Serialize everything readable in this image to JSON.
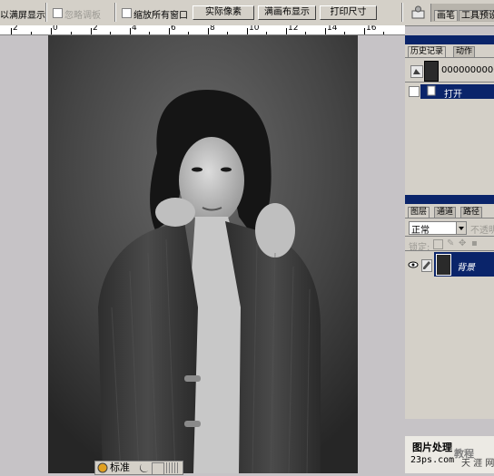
{
  "options_bar": {
    "fit_screen_label": "以满屏显示",
    "ignore_palettes_label": "忽略调板",
    "zoom_all_windows_label": "缩放所有窗口",
    "actual_pixels_label": "实际像素",
    "fit_screen_button_label": "满画布显示",
    "print_size_label": "打印尺寸",
    "brushes_tab_label": "画笔",
    "tool_presets_tab_label": "工具预设"
  },
  "ruler": {
    "labels": [
      "2",
      "0",
      "2",
      "4",
      "6",
      "8",
      "10",
      "12",
      "14",
      "16"
    ]
  },
  "history_panel": {
    "tabs": [
      "历史记录",
      "动作"
    ],
    "snapshot_name": "00000000000",
    "items": [
      {
        "label": "打开"
      }
    ]
  },
  "layers_panel": {
    "tabs": [
      "图层",
      "通道",
      "路径"
    ],
    "blend_mode": "正常",
    "opacity_label": "不透明",
    "lock_label": "锁定:",
    "layers": [
      {
        "name": "背景"
      }
    ]
  },
  "status_bar": {
    "screen_mode_label": "标准"
  },
  "watermark": {
    "title": "图片处理",
    "site": "23ps.com",
    "brand": "教程",
    "brand2": "天 涯 网"
  },
  "colors": {
    "panel_bg": "#d4d0c8",
    "title_blue": "#0a246a",
    "workspace": "#c6c3c6"
  }
}
